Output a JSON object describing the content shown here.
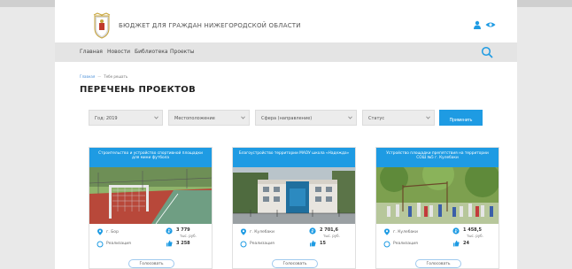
{
  "header": {
    "site_title": "БЮДЖЕТ ДЛЯ ГРАЖДАН НИЖЕГОРОДСКОЙ ОБЛАСТИ",
    "logo_icon": "coat-of-arms-icon",
    "user_icon": "user-icon",
    "accessibility_icon": "eye-icon"
  },
  "nav": {
    "items": [
      "Главная",
      "Новости",
      "Библиотека",
      "Проекты"
    ],
    "search_icon": "search-icon"
  },
  "breadcrumb": {
    "home": "Главная",
    "current": "Тебе решать"
  },
  "page_title": "ПЕРЕЧЕНЬ ПРОЕКТОВ",
  "filters": {
    "year": "Год: 2019",
    "location": "Местоположение",
    "sphere": "Сфера (направление)",
    "status": "Статус",
    "apply_label": "Применить"
  },
  "cards": [
    {
      "title": "Строительство и устройство спортивной площадки для мини футбола",
      "location": "г. Бор",
      "status": "Реализация",
      "amount": "3 779",
      "unit": "тыс. руб.",
      "likes": "3 258",
      "vote_label": "Голосовать"
    },
    {
      "title": "Благоустройство территории МАОУ школа «Надежда»",
      "location": "г. Кулебаки",
      "status": "Реализация",
      "amount": "2 701,6",
      "unit": "тыс. руб.",
      "likes": "15",
      "vote_label": "Голосовать"
    },
    {
      "title": "Устройство площадки препятствия на территории СОШ №5 г. Кулебаки",
      "location": "г. Кулебаки",
      "status": "Реализация",
      "amount": "1 458,5",
      "unit": "тыс. руб.",
      "likes": "24",
      "vote_label": "Голосовать"
    }
  ],
  "colors": {
    "accent": "#1e9be3",
    "nav_bg": "#e4e4e4",
    "page_bg": "#e9e9e9"
  }
}
